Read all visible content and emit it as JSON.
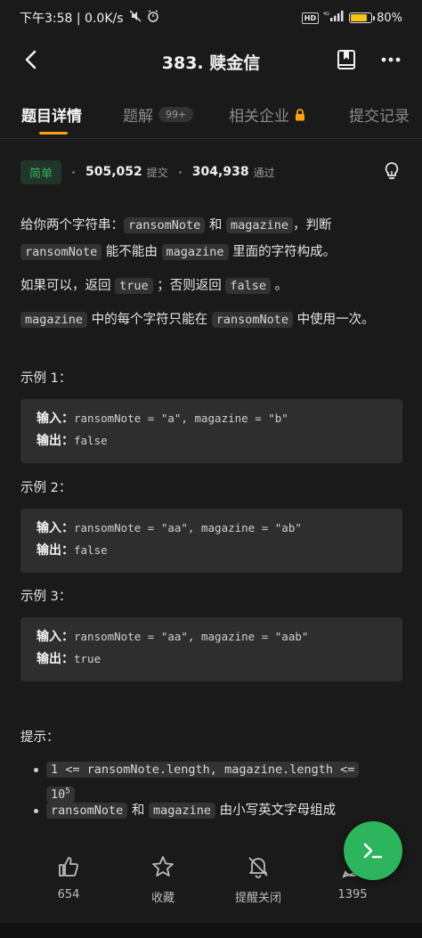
{
  "status_bar": {
    "time_speed": "下午3:58 | 0.0K/s",
    "battery_percent": "80%",
    "battery_level": 0.8,
    "hd": "HD"
  },
  "header": {
    "title": "383. 赎金信",
    "icons": [
      "back-arrow-icon",
      "book-icon",
      "more-icon"
    ]
  },
  "tabs": [
    {
      "label": "题目详情",
      "active": true
    },
    {
      "label": "题解",
      "badge": "99+"
    },
    {
      "label": "相关企业",
      "icon": "lock-icon"
    },
    {
      "label": "提交记录"
    }
  ],
  "stats": {
    "difficulty": "简单",
    "submissions": "505,052",
    "submissions_label": "提交",
    "accepted": "304,938",
    "accepted_label": "通过"
  },
  "description": {
    "p1_a": "给你两个字符串：",
    "p1_code1": "ransomNote",
    "p1_b": "和",
    "p1_code2": "magazine",
    "p1_c": "，判断",
    "p1_code3": "ransomNote",
    "p1_d": "能不能由",
    "p1_code4": "magazine",
    "p1_e": "里面的字符构成。",
    "p2_a": "如果可以，返回",
    "p2_code1": "true",
    "p2_b": "；否则返回",
    "p2_code2": "false",
    "p2_c": "。",
    "p3_code1": "magazine",
    "p3_a": "中的每个字符只能在",
    "p3_code2": "ransomNote",
    "p3_b": "中使用一次。"
  },
  "examples": [
    {
      "title": "示例 1：",
      "input_label": "输入：",
      "input": "ransomNote = \"a\", magazine = \"b\"",
      "output_label": "输出：",
      "output": "false"
    },
    {
      "title": "示例 2：",
      "input_label": "输入：",
      "input": "ransomNote = \"aa\", magazine = \"ab\"",
      "output_label": "输出：",
      "output": "false"
    },
    {
      "title": "示例 3：",
      "input_label": "输入：",
      "input": "ransomNote = \"aa\", magazine = \"aab\"",
      "output_label": "输出：",
      "output": "true"
    }
  ],
  "hints": {
    "title": "提示：",
    "h1_code": "1 <= ransomNote.length, magazine.length <=",
    "h1_base": "10",
    "h1_exp": "5",
    "h2_code1": "ransomNote",
    "h2_a": "和",
    "h2_code2": "magazine",
    "h2_b": "由小写英文字母组成"
  },
  "bottom_bar": {
    "likes": "654",
    "favorite": "收藏",
    "reminder": "提醒关闭",
    "comments": "1395"
  },
  "colors": {
    "background": "#1a1a1a",
    "accent_orange": "#ffa116",
    "easy_green": "#2db55d",
    "code_bg": "#333333"
  }
}
